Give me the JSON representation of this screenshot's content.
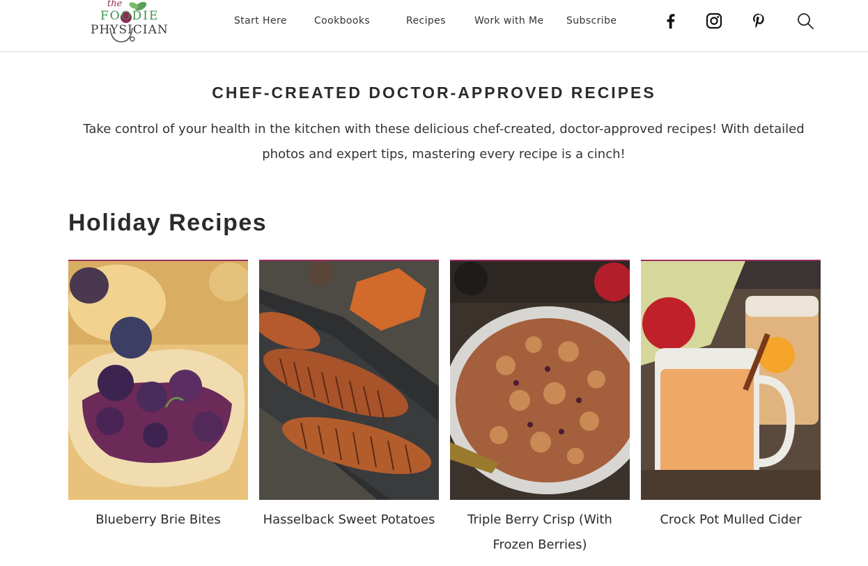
{
  "header": {
    "logo": {
      "line1": "the",
      "line2": "FOODIE",
      "line3": "PHYSICIAN"
    },
    "nav": [
      "Start Here",
      "Cookbooks",
      "Recipes",
      "Work with Me",
      "Subscribe"
    ],
    "icons": [
      "facebook-icon",
      "instagram-icon",
      "pinterest-icon",
      "search-icon"
    ]
  },
  "hero": {
    "title": "CHEF-CREATED DOCTOR-APPROVED RECIPES",
    "text": "Take control of your health in the kitchen with these delicious chef-created, doctor-approved recipes! With detailed photos and expert tips, mastering every recipe is a cinch!"
  },
  "section": {
    "title": "Holiday Recipes",
    "cards": [
      {
        "title": "Blueberry Brie Bites"
      },
      {
        "title": "Hasselback Sweet Potatoes"
      },
      {
        "title": "Triple Berry Crisp (With Frozen Berries)"
      },
      {
        "title": "Crock Pot Mulled Cider"
      }
    ]
  },
  "colors": {
    "accent": "#9a2c5d",
    "logo_green": "#3f8f4c",
    "text": "#2b2b2b"
  }
}
